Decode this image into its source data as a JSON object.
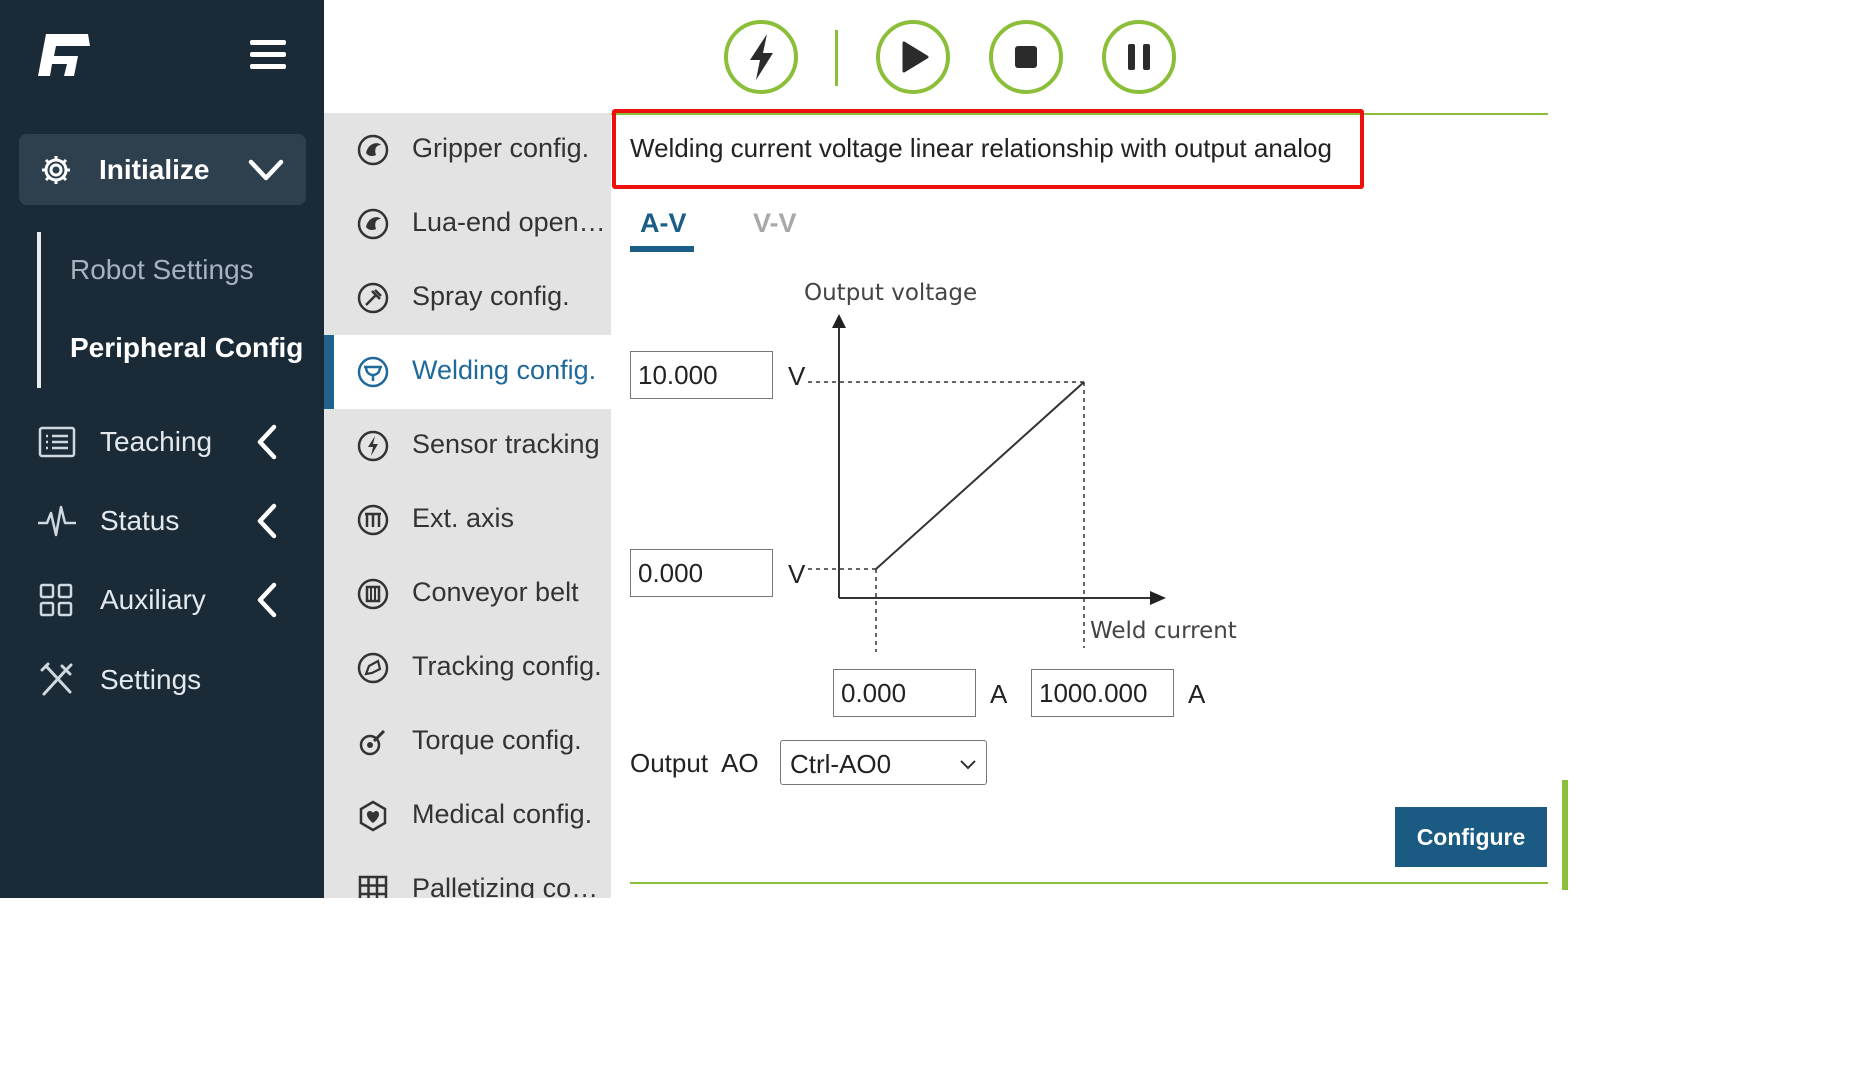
{
  "sidebar": {
    "initialize_label": "Initialize",
    "sub_items": [
      "Robot Settings",
      "Peripheral Config"
    ],
    "nav": [
      {
        "label": "Teaching",
        "icon": "list-icon"
      },
      {
        "label": "Status",
        "icon": "pulse-icon"
      },
      {
        "label": "Auxiliary",
        "icon": "grid-icon"
      },
      {
        "label": "Settings",
        "icon": "tools-icon"
      }
    ]
  },
  "toolbar": {
    "buttons": [
      "lightning-icon",
      "play-icon",
      "stop-icon",
      "pause-icon"
    ],
    "accent_color": "#8bbf3a"
  },
  "midlist": {
    "items": [
      {
        "label": "Gripper config.",
        "icon": "gripper-icon"
      },
      {
        "label": "Lua-end open…",
        "icon": "lua-end-icon"
      },
      {
        "label": "Spray config.",
        "icon": "spray-icon"
      },
      {
        "label": "Welding config.",
        "icon": "welding-icon",
        "active": true
      },
      {
        "label": "Sensor tracking",
        "icon": "sensor-icon"
      },
      {
        "label": "Ext. axis",
        "icon": "ext-axis-icon"
      },
      {
        "label": "Conveyor belt",
        "icon": "conveyor-icon"
      },
      {
        "label": "Tracking config.",
        "icon": "tracking-icon"
      },
      {
        "label": "Torque config.",
        "icon": "torque-icon"
      },
      {
        "label": "Medical config.",
        "icon": "medical-icon"
      },
      {
        "label": "Palletizing co…",
        "icon": "palletizing-icon"
      }
    ]
  },
  "main": {
    "heading": "Welding current voltage linear relationship with output analog",
    "tabs": [
      {
        "label": "A-V",
        "active": true
      },
      {
        "label": "V-V",
        "active": false
      }
    ],
    "chart": {
      "y_axis_label": "Output voltage",
      "x_axis_label": "Weld current"
    },
    "voltage_max": {
      "value": "10.000",
      "unit": "V"
    },
    "voltage_min": {
      "value": "0.000",
      "unit": "V"
    },
    "current_min": {
      "value": "0.000",
      "unit": "A"
    },
    "current_max": {
      "value": "1000.000",
      "unit": "A"
    },
    "output": {
      "label": "Output",
      "ao_label": "AO",
      "selected": "Ctrl-AO0"
    },
    "configure_label": "Configure"
  },
  "colors": {
    "sidebar_bg": "#1a2b37",
    "accent_green": "#8bbf3a",
    "primary_blue": "#1b5a82",
    "highlight_red": "#ee0f0f"
  }
}
